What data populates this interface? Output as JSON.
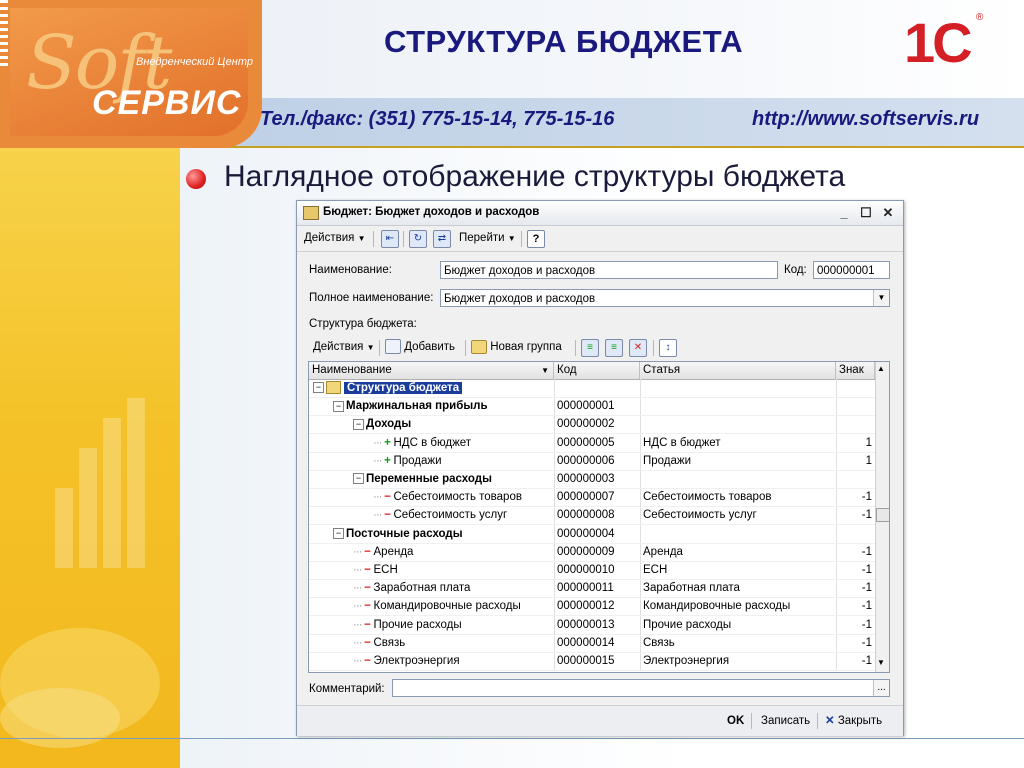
{
  "slide": {
    "logo": {
      "soft": "Soft",
      "center": "Внедренческий Центр",
      "servis": "СЕРВИС"
    },
    "title": "СТРУКТУРА БЮДЖЕТА",
    "brand": "1С",
    "brand_reg": "®",
    "phone": "Тел./факс: (351) 775-15-14, 775-15-16",
    "site": "http://www.softservis.ru",
    "subtitle": "Наглядное отображение структуры бюджета"
  },
  "window": {
    "title": "Бюджет: Бюджет доходов и расходов",
    "controls": {
      "minimize": "_",
      "maximize": "☐",
      "close": "✕"
    },
    "toolbar": {
      "actions": "Действия",
      "goto": "Перейти",
      "help": "?"
    },
    "form": {
      "name_label": "Наименование:",
      "name_value": "Бюджет доходов и расходов",
      "code_label": "Код:",
      "code_value": "000000001",
      "fullname_label": "Полное наименование:",
      "fullname_value": "Бюджет доходов и расходов",
      "structure_label": "Структура бюджета:",
      "comment_label": "Комментарий:",
      "comment_value": "",
      "comment_btn": "..."
    },
    "inner_toolbar": {
      "actions": "Действия",
      "add": "Добавить",
      "new_group": "Новая группа"
    },
    "grid": {
      "columns": [
        "Наименование",
        "Код",
        "Статья",
        "Знак"
      ],
      "rows": [
        {
          "level": 0,
          "type": "root",
          "name": "Структура бюджета",
          "code": "",
          "article": "",
          "sign": ""
        },
        {
          "level": 1,
          "type": "group",
          "name": "Маржинальная прибыль",
          "code": "000000001",
          "article": "",
          "sign": ""
        },
        {
          "level": 2,
          "type": "group",
          "name": "Доходы",
          "code": "000000002",
          "article": "",
          "sign": ""
        },
        {
          "level": 3,
          "type": "plus",
          "name": "НДС в бюджет",
          "code": "000000005",
          "article": "НДС в бюджет",
          "sign": "1"
        },
        {
          "level": 3,
          "type": "plus",
          "name": "Продажи",
          "code": "000000006",
          "article": "Продажи",
          "sign": "1"
        },
        {
          "level": 2,
          "type": "group",
          "name": "Переменные расходы",
          "code": "000000003",
          "article": "",
          "sign": ""
        },
        {
          "level": 3,
          "type": "minus",
          "name": "Себестоимость товаров",
          "code": "000000007",
          "article": "Себестоимость товаров",
          "sign": "-1"
        },
        {
          "level": 3,
          "type": "minus",
          "name": "Себестоимость услуг",
          "code": "000000008",
          "article": "Себестоимость услуг",
          "sign": "-1"
        },
        {
          "level": 1,
          "type": "group",
          "name": "Посточные расходы",
          "code": "000000004",
          "article": "",
          "sign": ""
        },
        {
          "level": 2,
          "type": "minus",
          "name": "Аренда",
          "code": "000000009",
          "article": "Аренда",
          "sign": "-1"
        },
        {
          "level": 2,
          "type": "minus",
          "name": "ЕСН",
          "code": "000000010",
          "article": "ЕСН",
          "sign": "-1"
        },
        {
          "level": 2,
          "type": "minus",
          "name": "Заработная плата",
          "code": "000000011",
          "article": "Заработная плата",
          "sign": "-1"
        },
        {
          "level": 2,
          "type": "minus",
          "name": "Командировочные расходы",
          "code": "000000012",
          "article": "Командировочные расходы",
          "sign": "-1"
        },
        {
          "level": 2,
          "type": "minus",
          "name": "Прочие расходы",
          "code": "000000013",
          "article": "Прочие расходы",
          "sign": "-1"
        },
        {
          "level": 2,
          "type": "minus",
          "name": "Связь",
          "code": "000000014",
          "article": "Связь",
          "sign": "-1"
        },
        {
          "level": 2,
          "type": "minus",
          "name": "Электроэнергия",
          "code": "000000015",
          "article": "Электроэнергия",
          "sign": "-1"
        }
      ]
    },
    "footer": {
      "ok": "OK",
      "save": "Записать",
      "close": "Закрыть"
    },
    "colors": {
      "selection": "#1a3d9c",
      "plus": "#10a020",
      "minus": "#e02020",
      "title_blue": "#1a1a7e",
      "brand_red": "#d41f26"
    }
  }
}
